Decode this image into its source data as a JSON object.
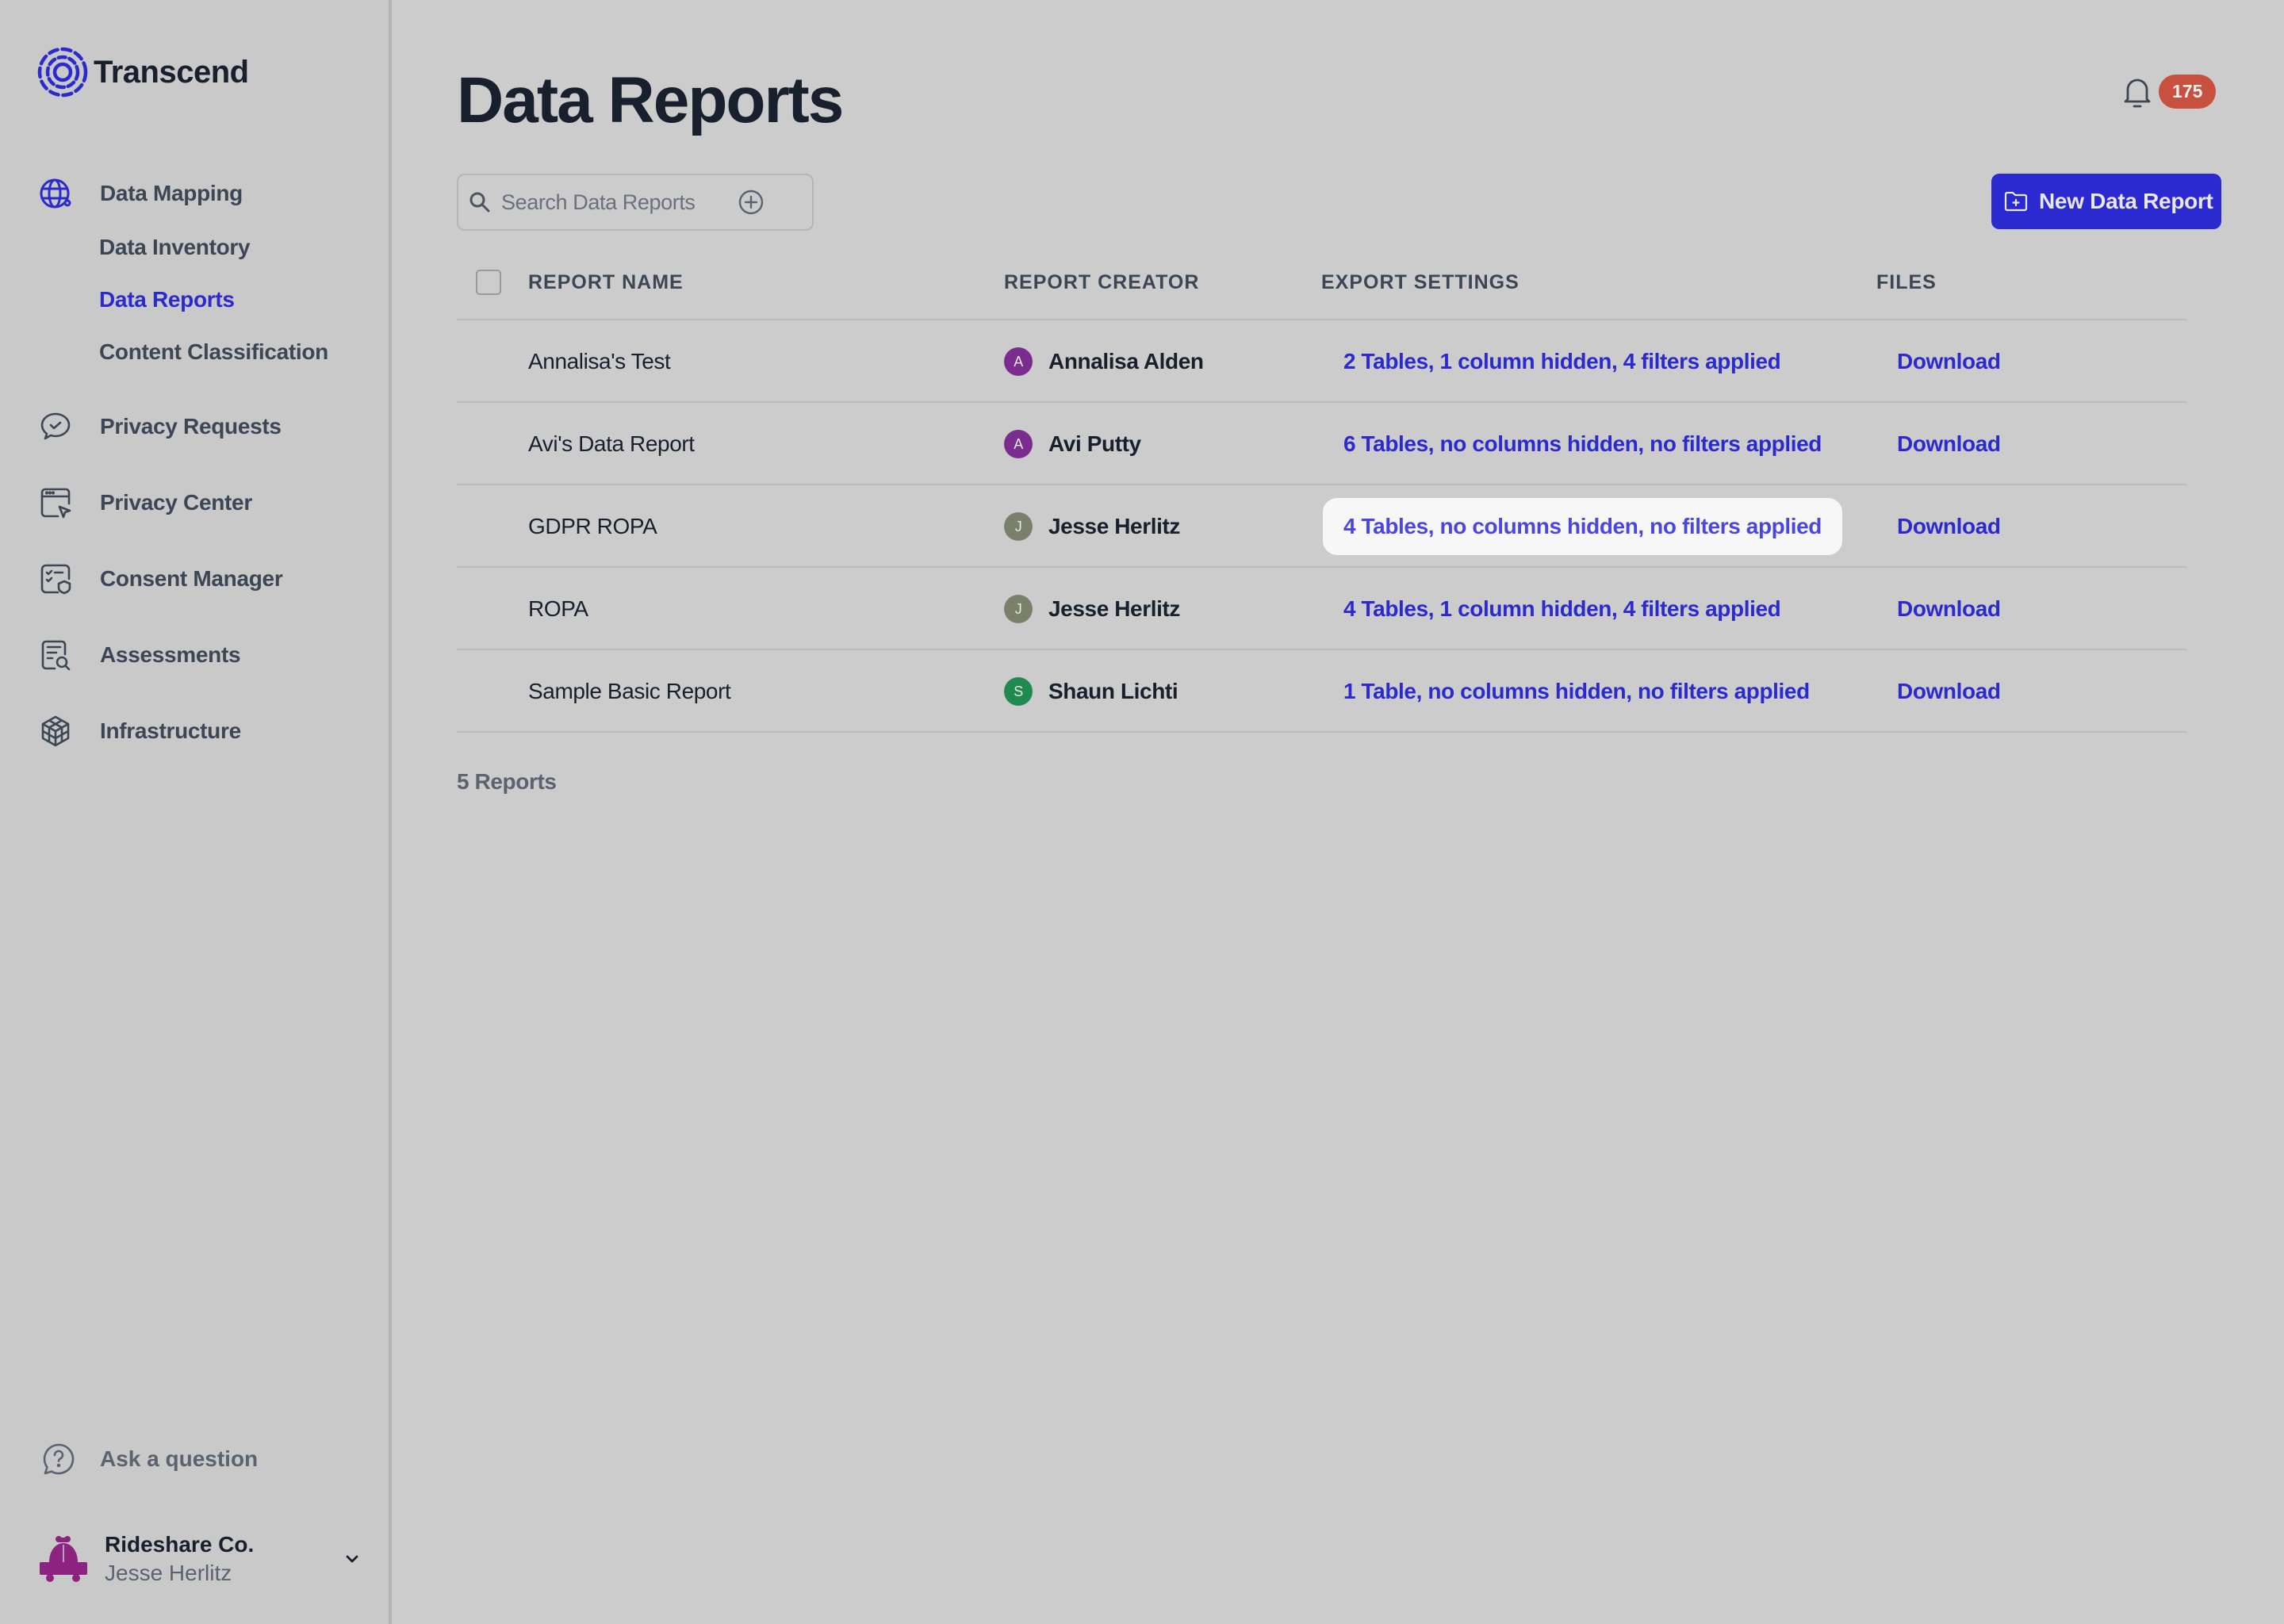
{
  "app": {
    "name": "Transcend"
  },
  "colors": {
    "accent": "#2b2ad0",
    "badge": "#c8503f",
    "highlight_bg": "#f7f7f8"
  },
  "sidebar": {
    "sections": [
      {
        "label": "Data Mapping",
        "icon": "globe-icon",
        "active": true,
        "children": [
          {
            "label": "Data Inventory",
            "active": false
          },
          {
            "label": "Data Reports",
            "active": true
          },
          {
            "label": "Content Classification",
            "active": false
          }
        ]
      },
      {
        "label": "Privacy Requests",
        "icon": "chat-check-icon"
      },
      {
        "label": "Privacy Center",
        "icon": "browser-cursor-icon"
      },
      {
        "label": "Consent Manager",
        "icon": "checklist-shield-icon"
      },
      {
        "label": "Assessments",
        "icon": "document-search-icon"
      },
      {
        "label": "Infrastructure",
        "icon": "cube-icon"
      }
    ],
    "help": {
      "label": "Ask a question",
      "icon": "question-chat-icon"
    },
    "account": {
      "org": "Rideshare Co.",
      "user": "Jesse Herlitz",
      "icon": "car-logo-icon"
    }
  },
  "header": {
    "title": "Data Reports",
    "notifications": {
      "count": "175",
      "icon": "bell-icon"
    },
    "search": {
      "placeholder": "Search Data Reports",
      "value": ""
    },
    "new_button": {
      "label": "New Data Report",
      "icon": "folder-plus-icon"
    }
  },
  "table": {
    "columns": [
      "REPORT NAME",
      "REPORT CREATOR",
      "EXPORT SETTINGS",
      "FILES"
    ],
    "rows": [
      {
        "name": "Annalisa's Test",
        "creator": "Annalisa Alden",
        "initial": "A",
        "avatar_color": "#7b2d8f",
        "export": "2 Tables, 1 column hidden, 4 filters applied",
        "file": "Download",
        "highlighted": false
      },
      {
        "name": "Avi's Data Report",
        "creator": "Avi Putty",
        "initial": "A",
        "avatar_color": "#7b2d8f",
        "export": "6 Tables, no columns hidden, no filters applied",
        "file": "Download",
        "highlighted": false
      },
      {
        "name": "GDPR ROPA",
        "creator": "Jesse Herlitz",
        "initial": "J",
        "avatar_color": "#7a806a",
        "export": "4 Tables, no columns hidden, no filters applied",
        "file": "Download",
        "highlighted": true
      },
      {
        "name": "ROPA",
        "creator": "Jesse Herlitz",
        "initial": "J",
        "avatar_color": "#7a806a",
        "export": "4 Tables, 1 column hidden, 4 filters applied",
        "file": "Download",
        "highlighted": false
      },
      {
        "name": "Sample Basic Report",
        "creator": "Shaun Lichti",
        "initial": "S",
        "avatar_color": "#208a4e",
        "export": "1 Table, no columns hidden, no filters applied",
        "file": "Download",
        "highlighted": false
      }
    ],
    "count_label": "5 Reports"
  }
}
